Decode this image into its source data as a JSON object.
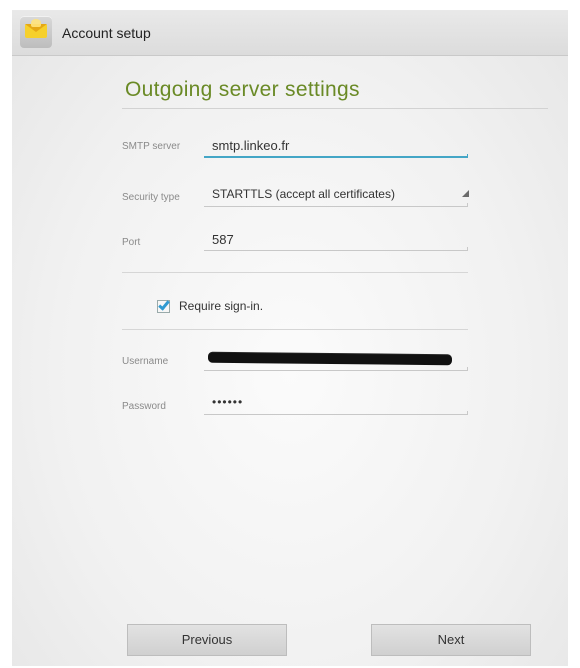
{
  "action_bar": {
    "title": "Account setup",
    "icon": "email-envelope-icon"
  },
  "heading": "Outgoing server settings",
  "form": {
    "smtp_server": {
      "label": "SMTP server",
      "value": "smtp.linkeo.fr"
    },
    "security_type": {
      "label": "Security type",
      "value": "STARTTLS (accept all certificates)"
    },
    "port": {
      "label": "Port",
      "value": "587"
    },
    "require_signin": {
      "label": "Require sign-in.",
      "checked": true
    },
    "username": {
      "label": "Username",
      "value": ""
    },
    "password": {
      "label": "Password",
      "value": "••••••"
    }
  },
  "buttons": {
    "previous": "Previous",
    "next": "Next"
  },
  "colors": {
    "heading": "#6a8a26",
    "focus_underline": "#44a6c6",
    "checkbox_tick": "#2f9ad1"
  }
}
